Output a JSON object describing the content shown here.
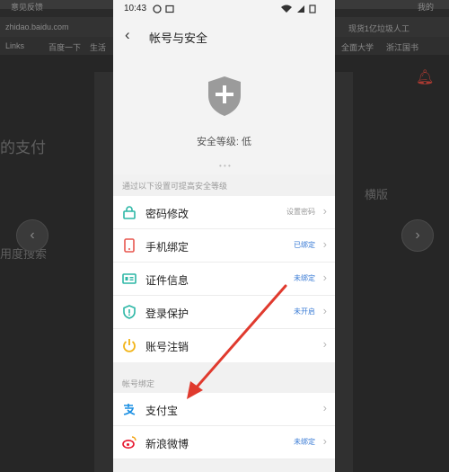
{
  "background": {
    "url": "zhidao.baidu.com",
    "tab_title_left": "意见反馈",
    "tab_title_right": "我的",
    "bookmark_left": "Links",
    "bookmark_items": [
      "百度一下",
      "生活"
    ],
    "search_right": "现货1亿垃圾人工",
    "bookmark_right": [
      "全面大学",
      "浙江国书"
    ],
    "page_left_text_1": "的支付",
    "page_left_text_2": "用度搜索",
    "page_right_text": "横版"
  },
  "phone": {
    "status_time": "10:43",
    "nav_title": "帐号与安全",
    "security_level": "安全等级: 低",
    "hint": "通过以下设置可提高安全等级",
    "items": [
      {
        "label": "密码修改",
        "status": "设置密码",
        "status_color": "#9a9a9a",
        "icon": "lock-icon",
        "icon_color": "#2db7a6"
      },
      {
        "label": "手机绑定",
        "status": "已绑定",
        "status_color": "#3a7bd5",
        "icon": "phone-icon",
        "icon_color": "#e8574f"
      },
      {
        "label": "证件信息",
        "status": "未绑定",
        "status_color": "#3a7bd5",
        "icon": "id-card-icon",
        "icon_color": "#2db7a6"
      },
      {
        "label": "登录保护",
        "status": "未开启",
        "status_color": "#3a7bd5",
        "icon": "shield-check-icon",
        "icon_color": "#2db7a6"
      },
      {
        "label": "账号注销",
        "status": "",
        "status_color": "#9a9a9a",
        "icon": "power-icon",
        "icon_color": "#f2b418"
      }
    ],
    "binding_section": "帐号绑定",
    "bindings": [
      {
        "label": "支付宝",
        "status": "",
        "status_color": "#3a7bd5",
        "icon": "alipay-icon",
        "icon_color": "#1a8fe3"
      },
      {
        "label": "新浪微博",
        "status": "未绑定",
        "status_color": "#3a7bd5",
        "icon": "weibo-icon",
        "icon_color": "#e6162d"
      }
    ]
  },
  "colors": {
    "annotation_arrow": "#e03a2e",
    "accent_blue": "#3a7bd5"
  }
}
